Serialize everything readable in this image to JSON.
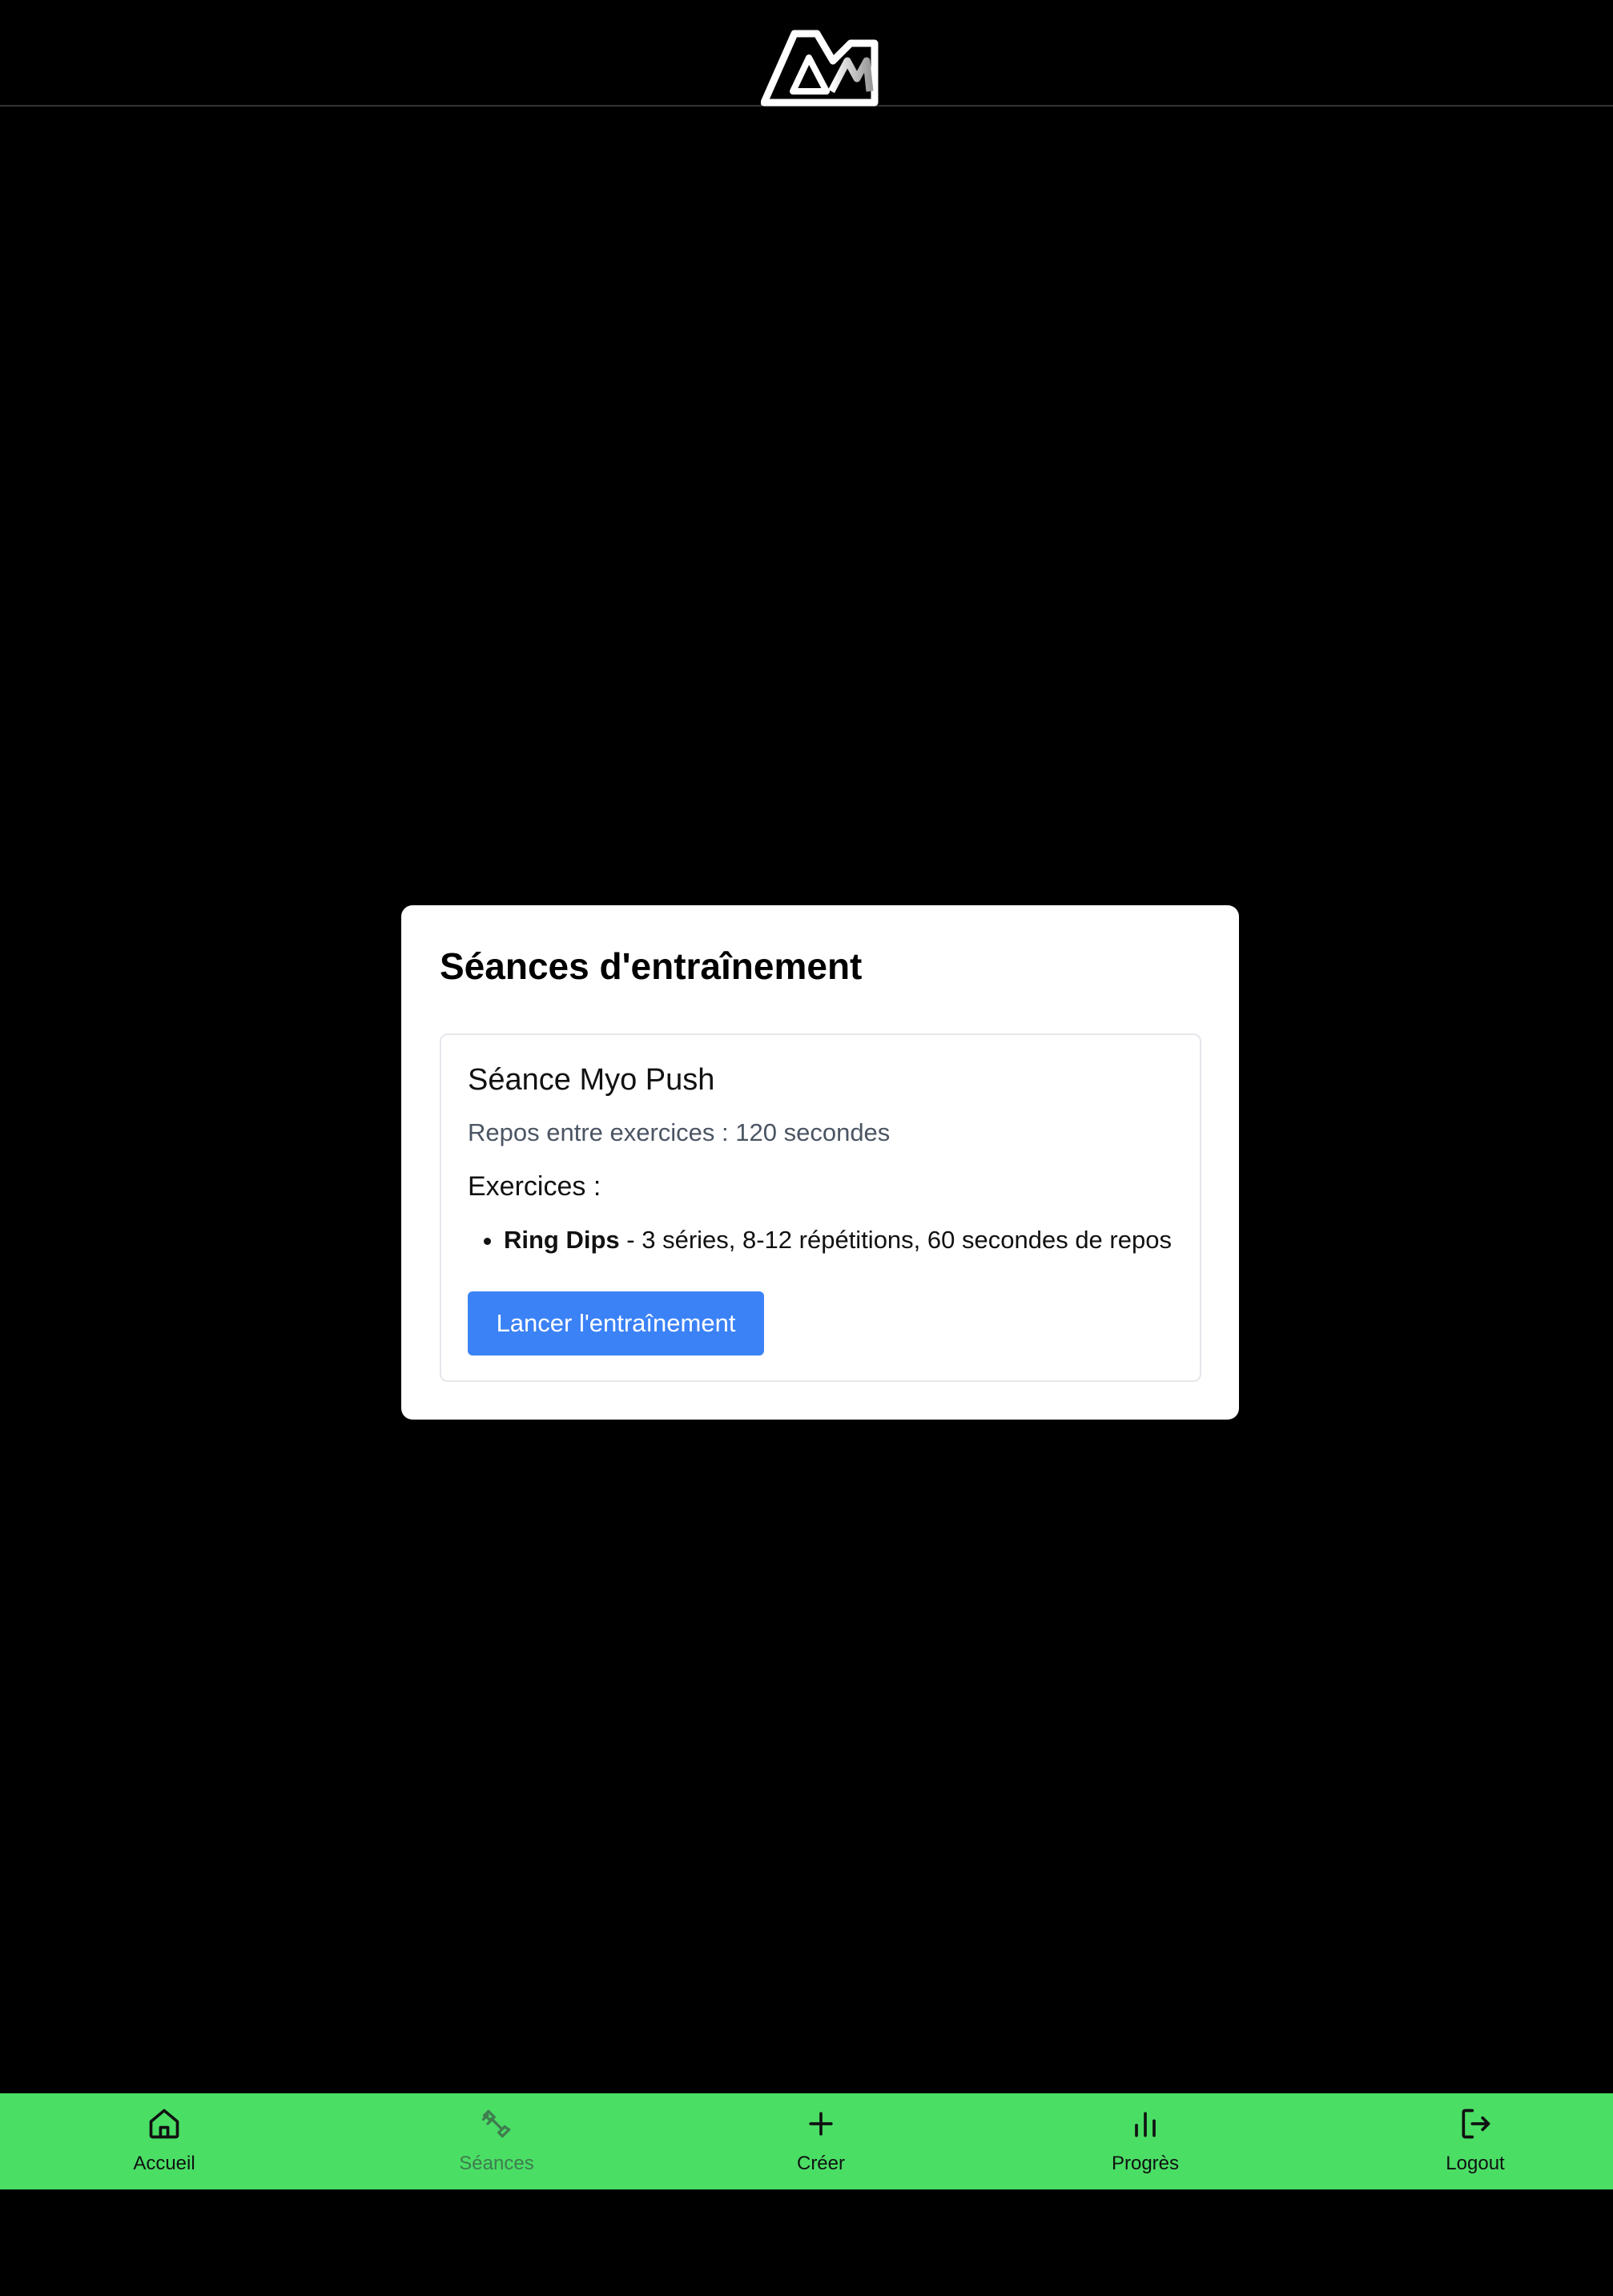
{
  "header": {
    "logo_name": "LM logo"
  },
  "card": {
    "title": "Séances d'entraînement",
    "session": {
      "title": "Séance Myo Push",
      "rest": "Repos entre exercices : 120 secondes",
      "exercises_heading": "Exercices :",
      "exercises": [
        {
          "name": "Ring Dips",
          "details": " - 3 séries, 8-12 répétitions, 60 secondes de repos"
        }
      ],
      "launch_label": "Lancer l'entraînement"
    }
  },
  "nav": {
    "items": [
      {
        "label": "Accueil",
        "icon": "home-icon"
      },
      {
        "label": "Séances",
        "icon": "dumbbell-icon"
      },
      {
        "label": "Créer",
        "icon": "plus-icon"
      },
      {
        "label": "Progrès",
        "icon": "bar-chart-icon"
      },
      {
        "label": "Logout",
        "icon": "logout-icon"
      }
    ],
    "active_index": 1
  },
  "colors": {
    "background": "#000000",
    "nav_background": "#4ade65",
    "accent_button": "#3b82f6",
    "active_nav": "#3f7d4e"
  }
}
